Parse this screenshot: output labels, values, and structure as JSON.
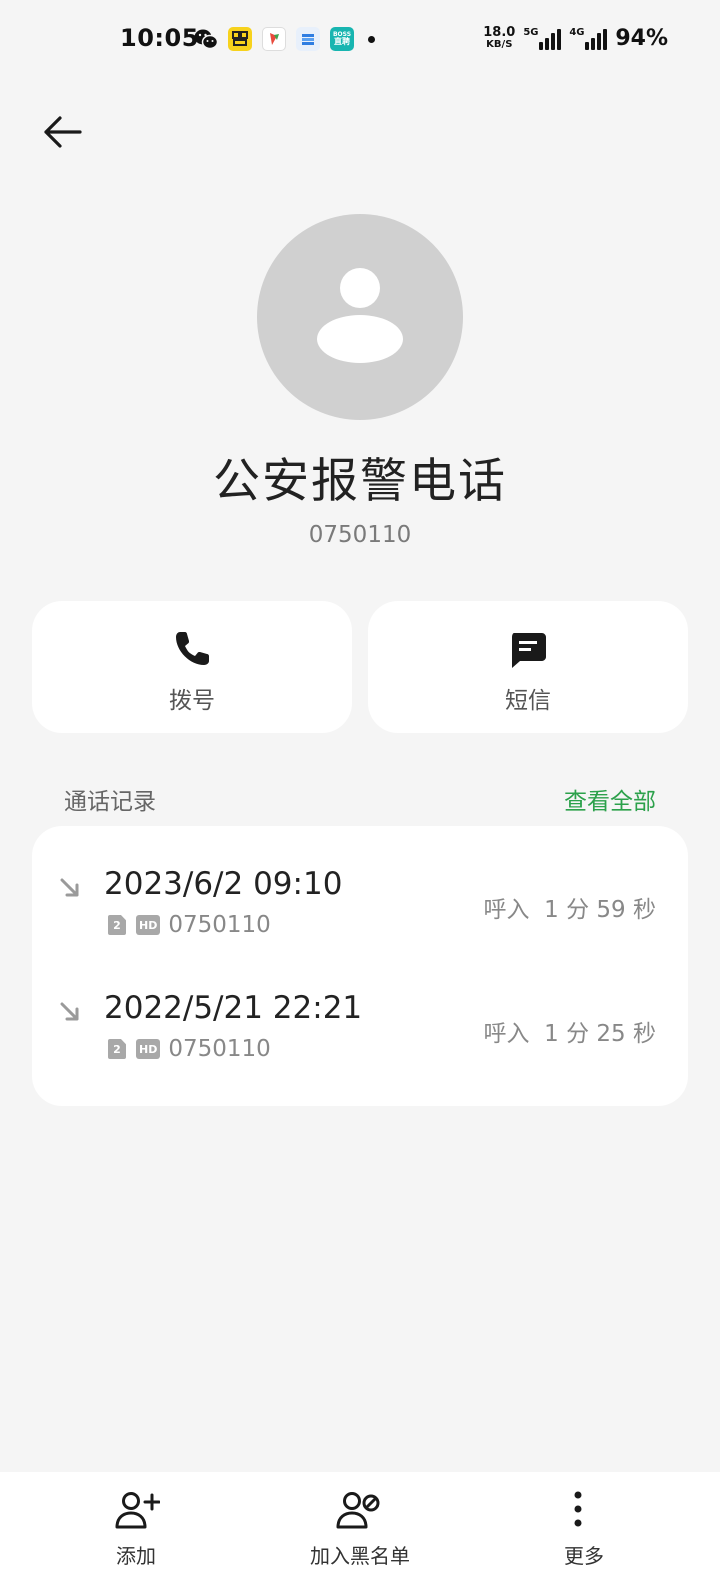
{
  "status_bar": {
    "time": "10:05",
    "apps": [
      "wechat-icon",
      "zhilian-icon",
      "app-red-icon",
      "app-blue-icon",
      "boss-icon"
    ],
    "boss_label_top": "BOSS",
    "boss_label_bottom": "直聘",
    "net_speed_value": "18.0",
    "net_speed_unit": "KB/S",
    "signal_1_label": "5G",
    "signal_2_label": "4G",
    "battery": "94%"
  },
  "contact": {
    "name": "公安报警电话",
    "number": "0750110"
  },
  "actions": {
    "dial_label": "拨号",
    "sms_label": "短信"
  },
  "call_log": {
    "title": "通话记录",
    "view_all": "查看全部",
    "entries": [
      {
        "datetime": "2023/6/2 09:10",
        "sim": "2",
        "hd": "HD",
        "number": "0750110",
        "info": "呼入  1 分 59 秒"
      },
      {
        "datetime": "2022/5/21 22:21",
        "sim": "2",
        "hd": "HD",
        "number": "0750110",
        "info": "呼入  1 分 25 秒"
      }
    ]
  },
  "bottom_bar": {
    "add_label": "添加",
    "block_label": "加入黑名单",
    "more_label": "更多"
  },
  "colors": {
    "background": "#f5f5f5",
    "card": "#ffffff",
    "accent_green": "#2ca14b",
    "avatar_bg": "#d0d0d0"
  }
}
